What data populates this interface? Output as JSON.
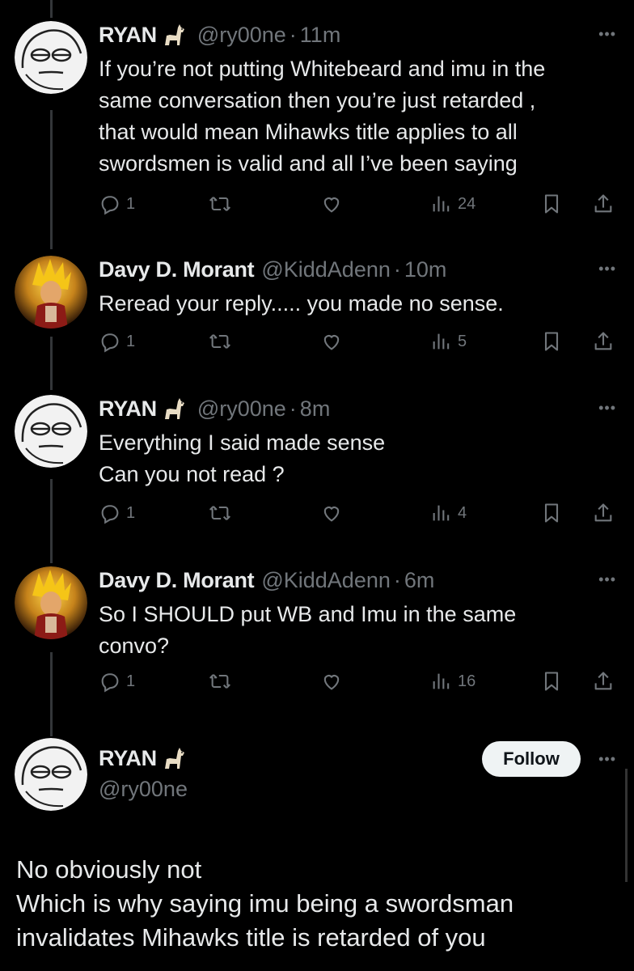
{
  "tweets": [
    {
      "name": "RYAN",
      "handle": "@ry00ne",
      "time": "11m",
      "lines": [
        "If you’re not putting Whitebeard and imu in the",
        "same conversation then you’re just retarded ,",
        "that would mean Mihawks title applies to all",
        "swordsmen is valid and all I’ve been saying"
      ],
      "replies": "1",
      "views": "24"
    },
    {
      "name": "Davy D. Morant",
      "handle": "@KiddAdenn",
      "time": "10m",
      "lines": [
        "Reread your reply..... you made no sense."
      ],
      "replies": "1",
      "views": "5"
    },
    {
      "name": "RYAN",
      "handle": "@ry00ne",
      "time": "8m",
      "lines": [
        "Everything I said made sense",
        "Can you not read ?"
      ],
      "replies": "1",
      "views": "4"
    },
    {
      "name": "Davy D. Morant",
      "handle": "@KiddAdenn",
      "time": "6m",
      "lines": [
        "So I SHOULD put WB and Imu in the same",
        "convo?"
      ],
      "replies": "1",
      "views": "16"
    }
  ],
  "main_tweet": {
    "name": "RYAN",
    "handle": "@ry00ne",
    "follow_label": "Follow",
    "lines": [
      "No obviously not",
      "Which is why saying imu being a swordsman",
      "invalidates Mihawks title is retarded of you"
    ]
  },
  "dot_separator": "·",
  "more_label": "•••",
  "colors": {
    "background": "#000000",
    "text": "#e7e9ea",
    "muted": "#71767b",
    "follow_bg": "#eff3f4"
  },
  "icons": [
    "reply-icon",
    "retweet-icon",
    "like-icon",
    "views-icon",
    "bookmark-icon",
    "share-icon",
    "llama-emoji",
    "more-icon"
  ]
}
